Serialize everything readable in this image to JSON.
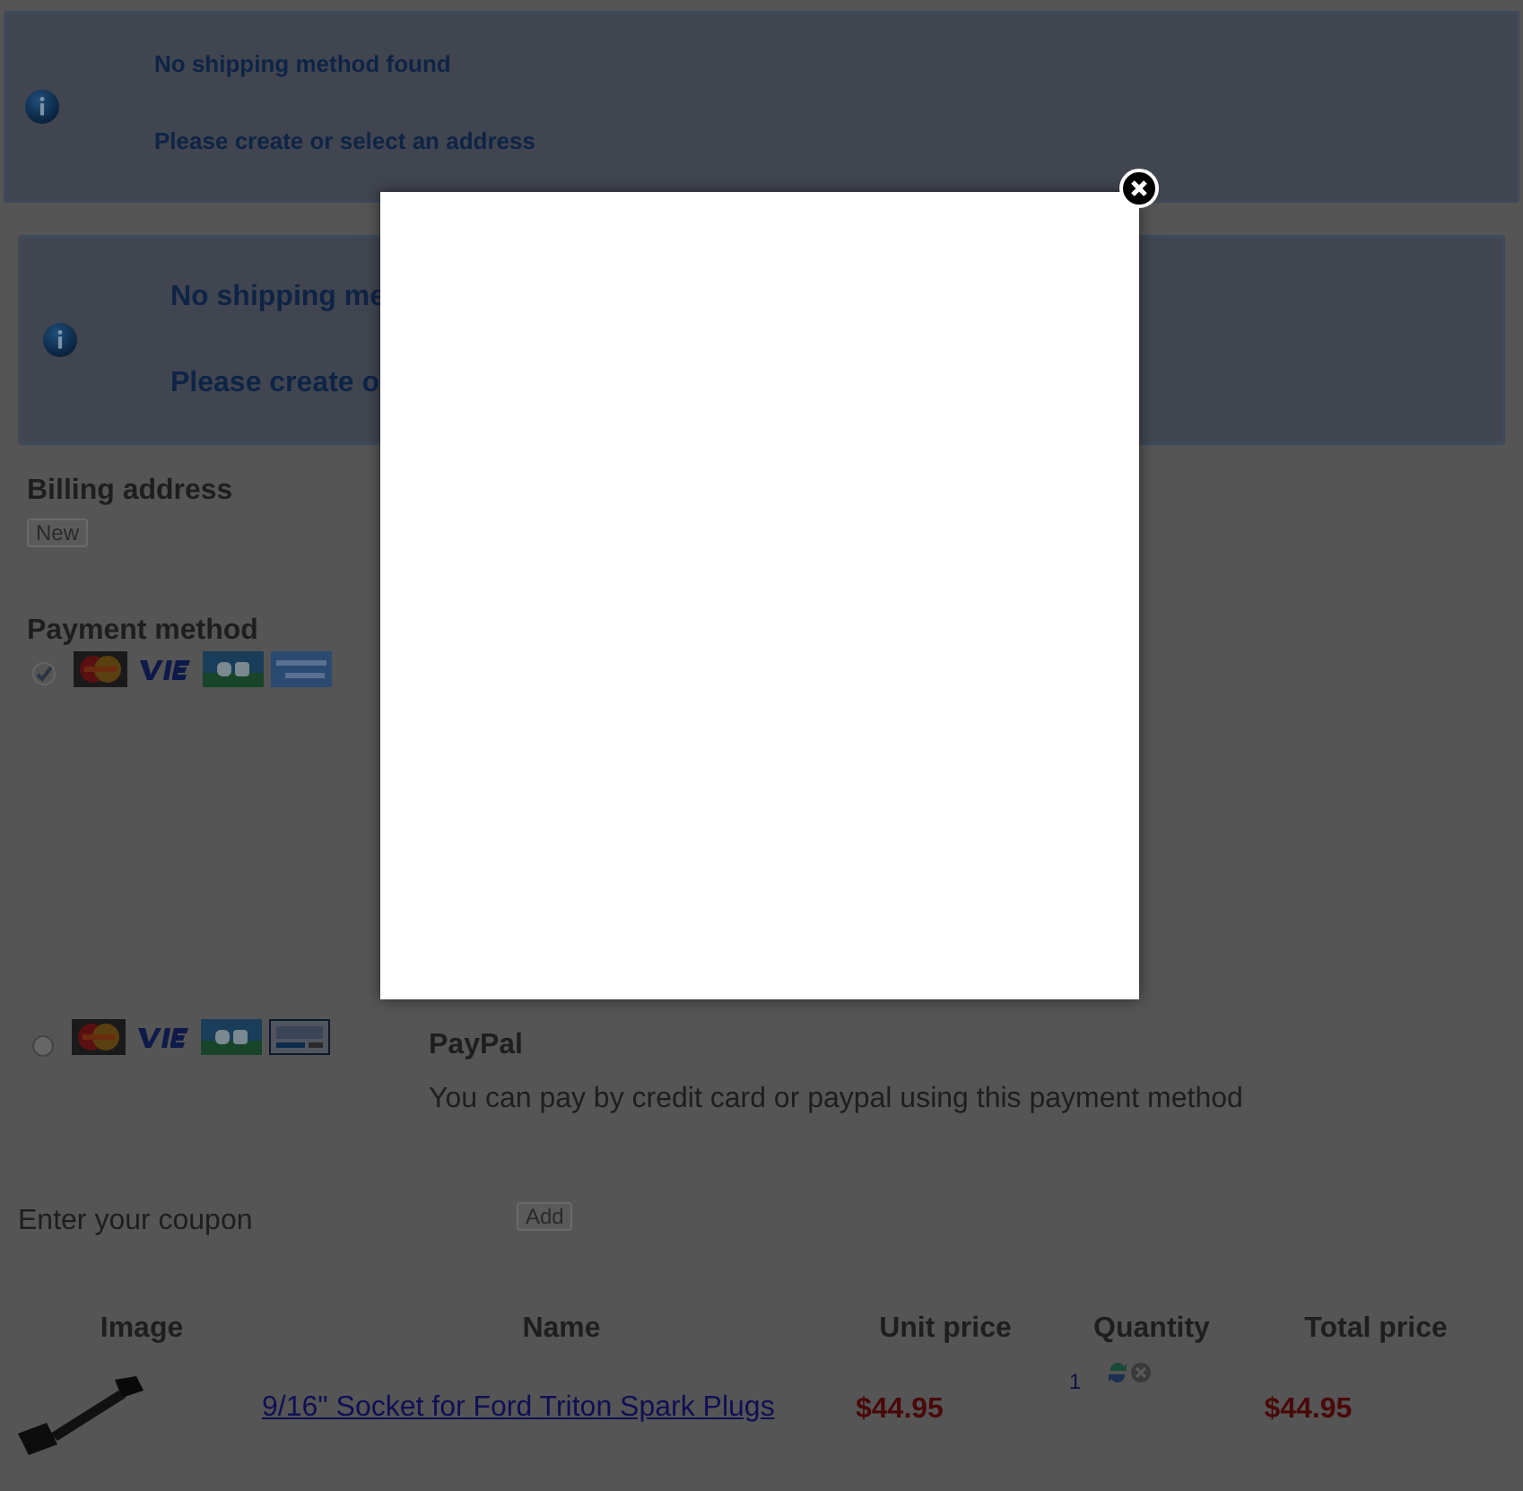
{
  "notices": [
    {
      "kind": "small",
      "lines": [
        "No shipping method found",
        "Please create or select an address"
      ]
    },
    {
      "kind": "large",
      "lines": [
        "No shipping me",
        "Please create o"
      ]
    }
  ],
  "billing": {
    "title": "Billing address",
    "button": "New"
  },
  "payment": {
    "title": "Payment method",
    "options": [
      {
        "kind": "checkbox",
        "checked": true,
        "logos": [
          {
            "kind": "mastercard"
          },
          {
            "kind": "visa"
          },
          {
            "kind": "cb"
          },
          {
            "kind": "amex"
          }
        ]
      },
      {
        "kind": "radio",
        "selected": false,
        "logos": [
          {
            "kind": "mastercard"
          },
          {
            "kind": "visa"
          },
          {
            "kind": "cb"
          },
          {
            "kind": "paypal"
          }
        ],
        "name": "PayPal",
        "description": "You can pay by credit card or paypal using this payment method"
      }
    ]
  },
  "coupon": {
    "label": "Enter your coupon",
    "button": "Add"
  },
  "cart": {
    "columns": [
      "Image",
      "Name",
      "Unit price",
      "Quantity",
      "Total price"
    ],
    "rows": [
      {
        "name": "9/16\" Socket for Ford Triton Spark Plugs",
        "unit_price": "$44.95",
        "quantity": "1",
        "total_price": "$44.95"
      }
    ]
  },
  "modal": {
    "open": true
  }
}
